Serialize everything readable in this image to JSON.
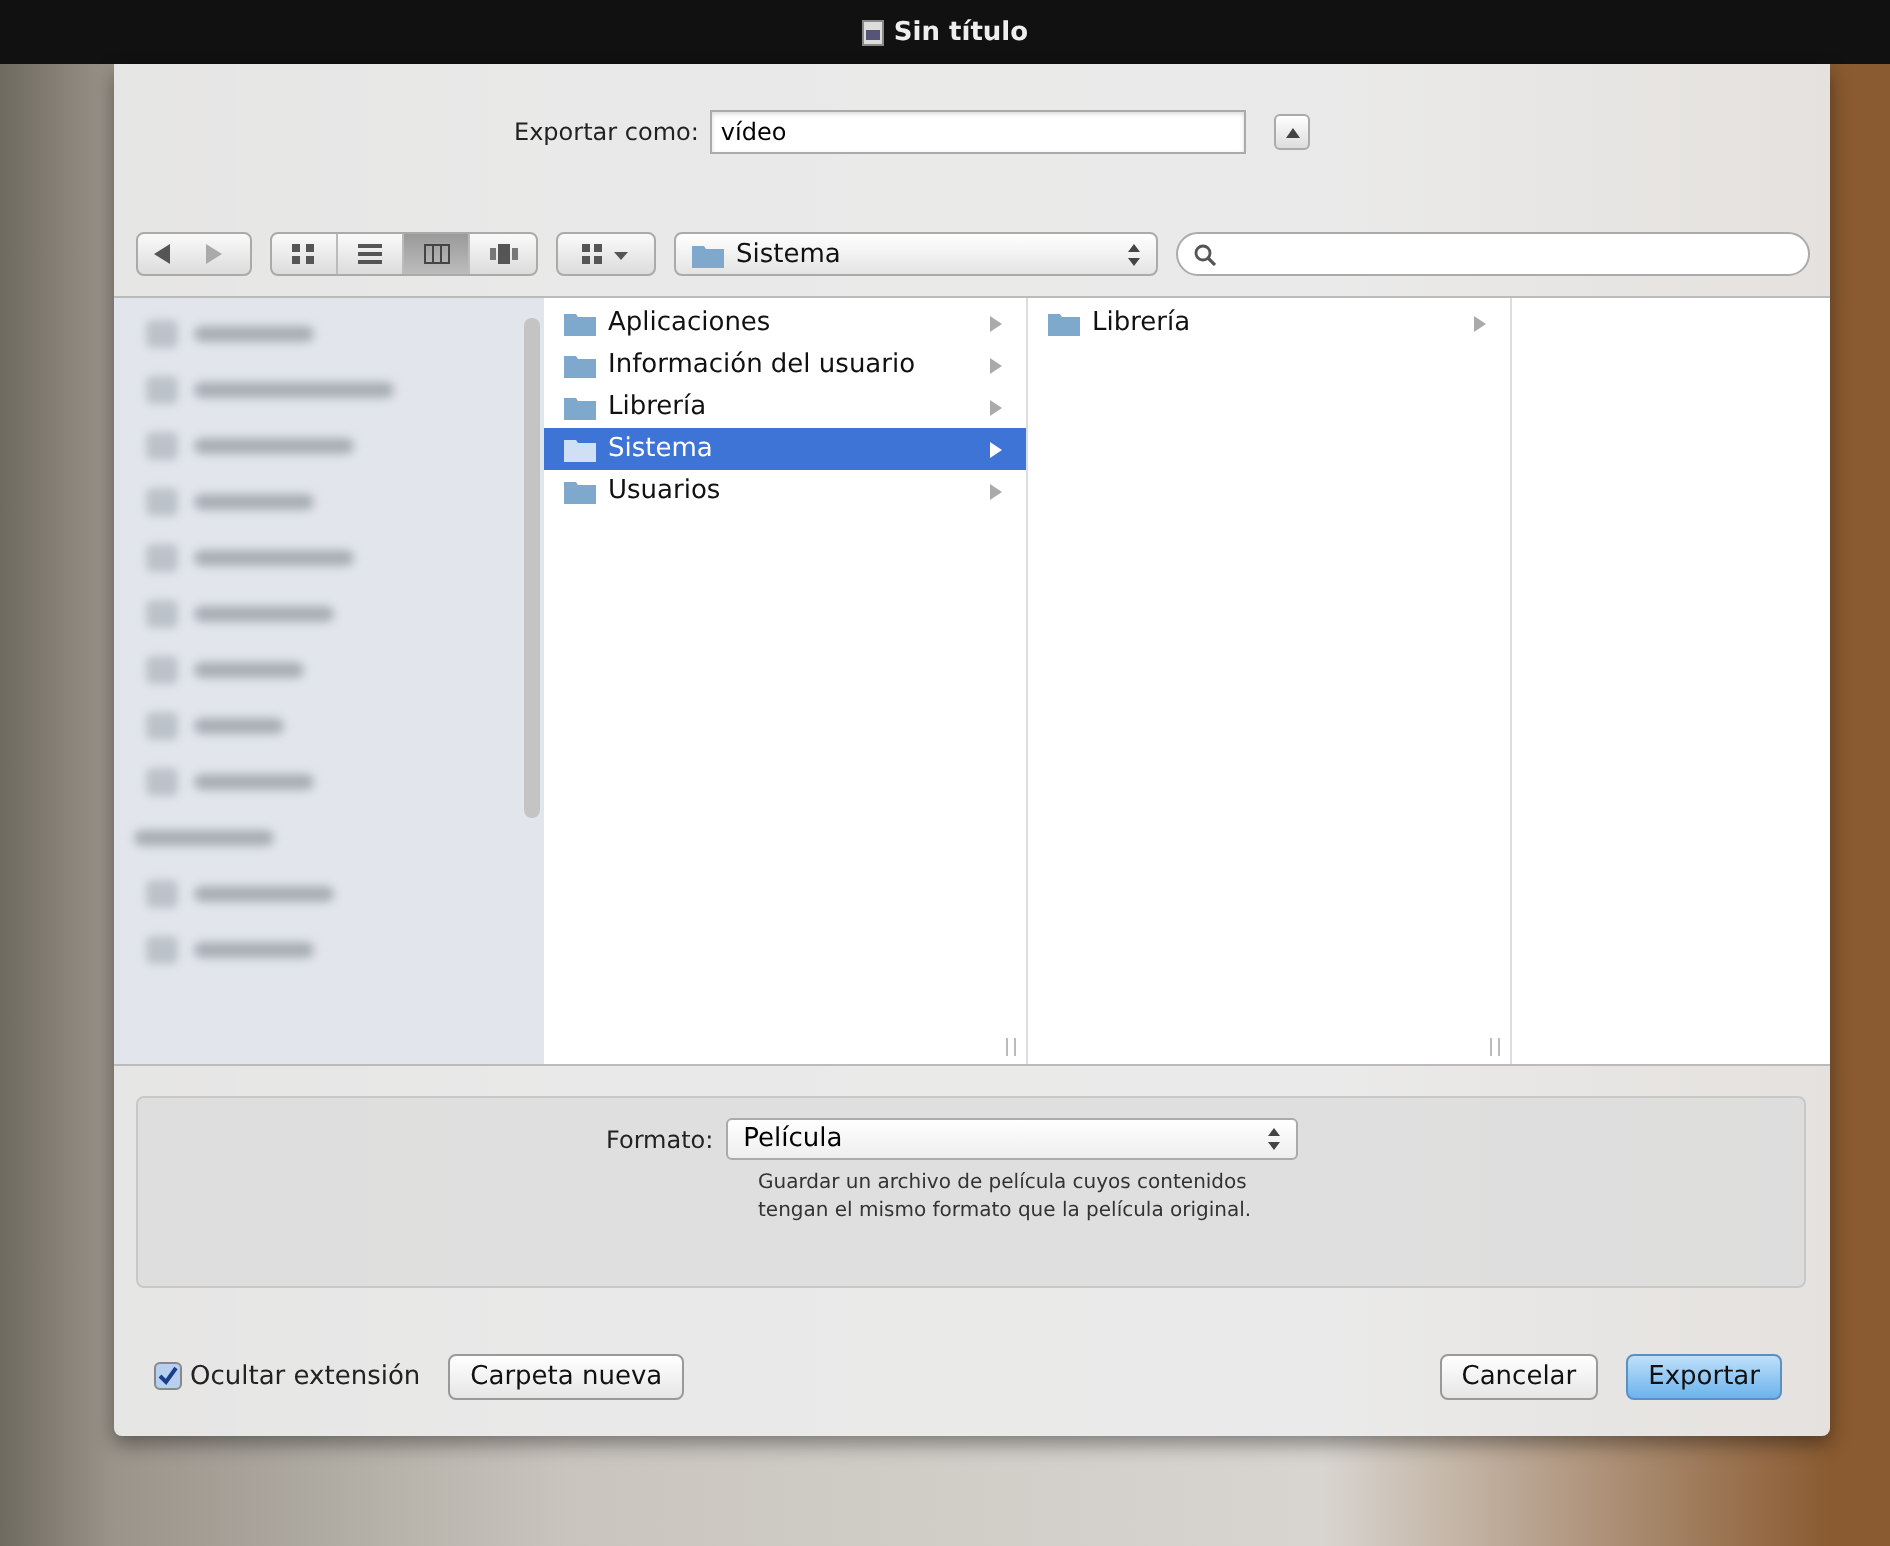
{
  "window": {
    "title": "Sin título"
  },
  "save_as": {
    "label": "Exportar como:",
    "value": "vídeo"
  },
  "toolbar": {
    "view_modes": [
      {
        "kind": "icons",
        "selected": false
      },
      {
        "kind": "list",
        "selected": false
      },
      {
        "kind": "columns",
        "selected": true
      },
      {
        "kind": "coverflow",
        "selected": false
      }
    ],
    "location": "Sistema"
  },
  "browser": {
    "columns": [
      {
        "items": [
          {
            "name": "Aplicaciones",
            "selected": false
          },
          {
            "name": "Información del usuario",
            "selected": false
          },
          {
            "name": "Librería",
            "selected": false
          },
          {
            "name": "Sistema",
            "selected": true
          },
          {
            "name": "Usuarios",
            "selected": false
          }
        ]
      },
      {
        "items": [
          {
            "name": "Librería",
            "selected": false
          }
        ]
      }
    ]
  },
  "format": {
    "label": "Formato:",
    "value": "Película",
    "description": "Guardar un archivo de película cuyos contenidos tengan el mismo formato que la película original."
  },
  "hide_extension": {
    "label": "Ocultar extensión",
    "checked": true
  },
  "left_buttons": [
    {
      "label": "Carpeta nueva"
    }
  ],
  "right_buttons": [
    {
      "label": "Cancelar",
      "kind": "normal"
    },
    {
      "label": "Exportar",
      "kind": "default"
    }
  ]
}
